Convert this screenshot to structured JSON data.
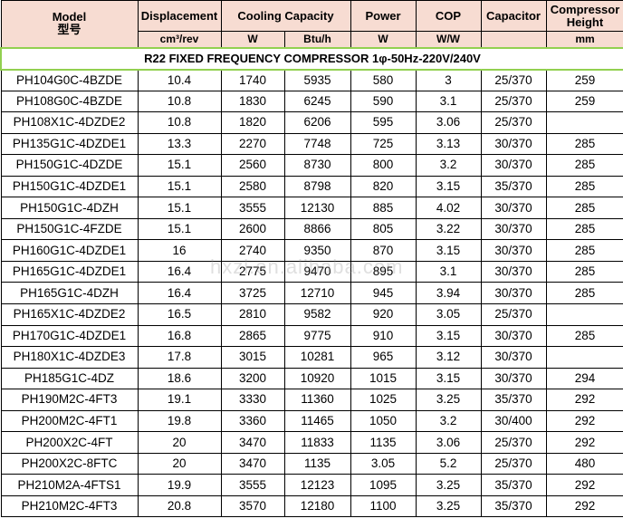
{
  "header": {
    "model": "Model",
    "model_cn": "型号",
    "displacement": "Displacement",
    "cooling_capacity": "Cooling Capacity",
    "power": "Power",
    "cop": "COP",
    "capacitor": "Capacitor",
    "compressor_height": "Compressor Height",
    "units": {
      "displacement": "cm³/rev",
      "cooling_w": "W",
      "cooling_btu": "Btu/h",
      "power": "W",
      "cop": "W/W",
      "capacitor": "",
      "height": "mm"
    }
  },
  "section_title": "R22 FIXED FREQUENCY COMPRESSOR 1φ-50Hz-220V/240V",
  "watermark": "hxzl.en.alibaba.com",
  "colors": {
    "header_bg": "#f7dcd2",
    "section_border": "#92d050"
  },
  "rows": [
    {
      "model": "PH104G0C-4BZDE",
      "disp": "10.4",
      "w": "1740",
      "btu": "5935",
      "power": "580",
      "cop": "3",
      "cap": "25/370",
      "height": "259"
    },
    {
      "model": "PH108G0C-4BZDE",
      "disp": "10.8",
      "w": "1830",
      "btu": "6245",
      "power": "590",
      "cop": "3.1",
      "cap": "25/370",
      "height": "259"
    },
    {
      "model": "PH108X1C-4DZDE2",
      "disp": "10.8",
      "w": "1820",
      "btu": "6206",
      "power": "595",
      "cop": "3.06",
      "cap": "25/370",
      "height": ""
    },
    {
      "model": "PH135G1C-4DZDE1",
      "disp": "13.3",
      "w": "2270",
      "btu": "7748",
      "power": "725",
      "cop": "3.13",
      "cap": "30/370",
      "height": "285"
    },
    {
      "model": "PH150G1C-4DZDE",
      "disp": "15.1",
      "w": "2560",
      "btu": "8730",
      "power": "800",
      "cop": "3.2",
      "cap": "30/370",
      "height": "285"
    },
    {
      "model": "PH150G1C-4DZDE1",
      "disp": "15.1",
      "w": "2580",
      "btu": "8798",
      "power": "820",
      "cop": "3.15",
      "cap": "35/370",
      "height": "285"
    },
    {
      "model": "PH150G1C-4DZH",
      "disp": "15.1",
      "w": "3555",
      "btu": "12130",
      "power": "885",
      "cop": "4.02",
      "cap": "30/370",
      "height": "285"
    },
    {
      "model": "PH150G1C-4FZDE",
      "disp": "15.1",
      "w": "2600",
      "btu": "8866",
      "power": "805",
      "cop": "3.22",
      "cap": "30/370",
      "height": "285"
    },
    {
      "model": "PH160G1C-4DZDE1",
      "disp": "16",
      "w": "2740",
      "btu": "9350",
      "power": "870",
      "cop": "3.15",
      "cap": "30/370",
      "height": "285"
    },
    {
      "model": "PH165G1C-4DZDE1",
      "disp": "16.4",
      "w": "2775",
      "btu": "9470",
      "power": "895",
      "cop": "3.1",
      "cap": "30/370",
      "height": "285"
    },
    {
      "model": "PH165G1C-4DZH",
      "disp": "16.4",
      "w": "3725",
      "btu": "12710",
      "power": "945",
      "cop": "3.94",
      "cap": "30/370",
      "height": "285"
    },
    {
      "model": "PH165X1C-4DZDE2",
      "disp": "16.5",
      "w": "2810",
      "btu": "9582",
      "power": "920",
      "cop": "3.05",
      "cap": "25/370",
      "height": ""
    },
    {
      "model": "PH170G1C-4DZDE1",
      "disp": "16.8",
      "w": "2865",
      "btu": "9775",
      "power": "910",
      "cop": "3.15",
      "cap": "30/370",
      "height": "285"
    },
    {
      "model": "PH180X1C-4DZDE3",
      "disp": "17.8",
      "w": "3015",
      "btu": "10281",
      "power": "965",
      "cop": "3.12",
      "cap": "30/370",
      "height": ""
    },
    {
      "model": "PH185G1C-4DZ",
      "disp": "18.6",
      "w": "3200",
      "btu": "10920",
      "power": "1015",
      "cop": "3.15",
      "cap": "30/370",
      "height": "294"
    },
    {
      "model": "PH190M2C-4FT3",
      "disp": "19.1",
      "w": "3330",
      "btu": "11360",
      "power": "1025",
      "cop": "3.25",
      "cap": "35/370",
      "height": "292"
    },
    {
      "model": "PH200M2C-4FT1",
      "disp": "19.8",
      "w": "3360",
      "btu": "11465",
      "power": "1050",
      "cop": "3.2",
      "cap": "30/400",
      "height": "292"
    },
    {
      "model": "PH200X2C-4FT",
      "disp": "20",
      "w": "3470",
      "btu": "11833",
      "power": "1135",
      "cop": "3.06",
      "cap": "25/370",
      "height": "292"
    },
    {
      "model": "PH200X2C-8FTC",
      "disp": "20",
      "w": "3470",
      "btu": "1135",
      "power": "3.05",
      "cop": "5.2",
      "cap": "25/370",
      "height": "480"
    },
    {
      "model": "PH210M2A-4FTS1",
      "disp": "19.9",
      "w": "3555",
      "btu": "12123",
      "power": "1095",
      "cop": "3.25",
      "cap": "35/370",
      "height": "292"
    },
    {
      "model": "PH210M2C-4FT3",
      "disp": "20.8",
      "w": "3570",
      "btu": "12180",
      "power": "1100",
      "cop": "3.25",
      "cap": "35/370",
      "height": "292"
    }
  ]
}
